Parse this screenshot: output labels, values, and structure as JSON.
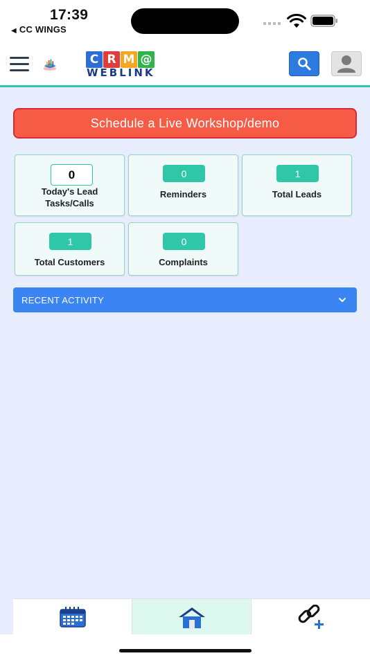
{
  "status_bar": {
    "time": "17:39",
    "back_app": "CC WINGS",
    "icons": [
      "signal-icon",
      "wifi-icon",
      "battery-icon"
    ]
  },
  "header": {
    "logo_letters": [
      "C",
      "R",
      "M",
      "@"
    ],
    "logo_letter_colors": [
      "#2a6fd6",
      "#e23b3b",
      "#f5a623",
      "#2fb34a"
    ],
    "logo_subtitle": "WEBLINK",
    "icons": [
      "menu-icon",
      "search-icon",
      "user-icon"
    ]
  },
  "schedule_button": {
    "label": "Schedule a Live Workshop/demo"
  },
  "cards": [
    {
      "value": "0",
      "label": "Today's Lead\nTasks/Calls"
    },
    {
      "value": "0",
      "label": "Reminders"
    },
    {
      "value": "1",
      "label": "Total Leads"
    },
    {
      "value": "1",
      "label": "Total Customers"
    },
    {
      "value": "0",
      "label": "Complaints"
    }
  ],
  "recent_activity": {
    "label": "RECENT ACTIVITY"
  },
  "bottom_nav": {
    "items": [
      {
        "icon": "calendar-icon"
      },
      {
        "icon": "home-icon",
        "active": true
      },
      {
        "icon": "add-link-icon"
      }
    ]
  },
  "colors": {
    "accent_teal": "#2fc7a8",
    "schedule_red": "#f65c45",
    "recent_blue": "#3a84f3",
    "background": "#e8edfd"
  }
}
